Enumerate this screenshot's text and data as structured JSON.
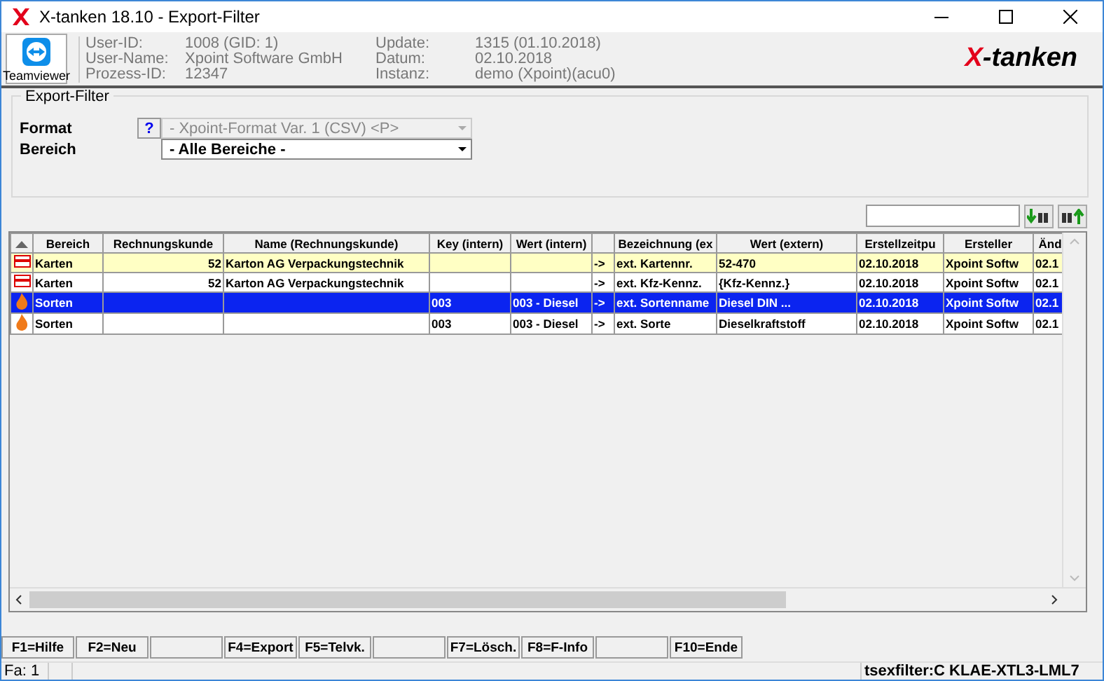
{
  "window": {
    "title": "X-tanken 18.10  - Export-Filter"
  },
  "teamviewer": {
    "label": "Teamviewer"
  },
  "info": [
    {
      "label": "User-ID:",
      "value": "1008 (GID: 1)"
    },
    {
      "label": "User-Name:",
      "value": "Xpoint Software GmbH"
    },
    {
      "label": "Prozess-ID:",
      "value": "12347"
    },
    {
      "label": "Update:",
      "value": "1315 (01.10.2018)"
    },
    {
      "label": "Datum:",
      "value": "02.10.2018"
    },
    {
      "label": "Instanz:",
      "value": "demo (Xpoint)(acu0)"
    }
  ],
  "logo": {
    "mark": "X",
    "text": "-tanken"
  },
  "filter": {
    "title": "Export-Filter",
    "fields": [
      {
        "label": "Format",
        "help": "?",
        "value": "- Xpoint-Format Var. 1 (CSV) <P>",
        "disabled": true
      },
      {
        "label": "Bereich",
        "value": "- Alle Bereiche -",
        "disabled": false
      }
    ]
  },
  "table": {
    "columns": [
      "Bereich",
      "Rechnungskunde",
      "Name (Rechnungskunde)",
      "Key (intern)",
      "Wert (intern)",
      null,
      "Bezeichnung (ex",
      "Wert (extern)",
      "Erstellzeitpu",
      "Ersteller",
      "Änd"
    ],
    "rows": [
      {
        "kind": "card",
        "selected": false,
        "marked": true,
        "cells": [
          "Karten",
          "52",
          "Karton AG Verpackungstechnik",
          "",
          "",
          "->",
          "ext. Kartennr.",
          "52-470",
          "02.10.2018",
          "Xpoint Softw",
          "02.1"
        ]
      },
      {
        "kind": "card",
        "selected": false,
        "marked": false,
        "cells": [
          "Karten",
          "52",
          "Karton AG Verpackungstechnik",
          "",
          "",
          "->",
          "ext. Kfz-Kennz.",
          "{Kfz-Kennz.}",
          "02.10.2018",
          "Xpoint Softw",
          "02.1"
        ]
      },
      {
        "kind": "flame",
        "selected": true,
        "marked": false,
        "cells": [
          "Sorten",
          "",
          "",
          "003",
          "003 - Diesel",
          "->",
          "ext. Sortenname",
          "Diesel DIN ...",
          "02.10.2018",
          "Xpoint Softw",
          "02.1"
        ]
      },
      {
        "kind": "flame",
        "selected": false,
        "marked": false,
        "cells": [
          "Sorten",
          "",
          "",
          "003",
          "003 - Diesel",
          "->",
          "ext. Sorte",
          "Dieselkraftstoff",
          "02.10.2018",
          "Xpoint Softw",
          "02.1"
        ]
      }
    ]
  },
  "function_keys": [
    {
      "kind": "key",
      "label": "F1=Hilfe"
    },
    {
      "kind": "key",
      "label": "F2=Neu"
    },
    {
      "kind": "blank"
    },
    {
      "kind": "key",
      "label": "F4=Export"
    },
    {
      "kind": "key",
      "label": "F5=Telvk."
    },
    {
      "kind": "blank"
    },
    {
      "kind": "key",
      "label": "F7=Lösch."
    },
    {
      "kind": "key",
      "label": "F8=F-Info"
    },
    {
      "kind": "blank"
    },
    {
      "kind": "key",
      "label": "F10=Ende"
    }
  ],
  "status_bar": {
    "left": "Fa: 1",
    "right": "tsexfilter:C KLAE-XTL3-LML7"
  }
}
